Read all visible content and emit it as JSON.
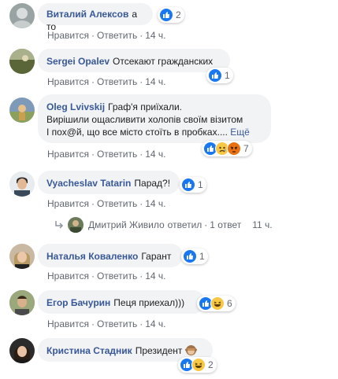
{
  "colors": {
    "link": "#385898",
    "bubble": "#f2f3f5",
    "meta": "#606770",
    "like": "#1877f2"
  },
  "actions": {
    "like": "Нравится",
    "reply": "Ответить"
  },
  "comments": [
    {
      "author": "Виталий Алексов",
      "text": "а то",
      "reactions": [
        "like"
      ],
      "count": "2",
      "time": "14 ч."
    },
    {
      "author": "Sergei Opalev",
      "text": "Отсекают гражданских",
      "reactions": [
        "like"
      ],
      "count": "1",
      "time": "14 ч."
    },
    {
      "author": "Oleg Lvivskij",
      "line1": "Граф'я приїхали.",
      "line2": "Вирішили ощасливити холопів своїм візитом",
      "line3": "І пох@й, що все місто стоїть в пробках....",
      "more": "Ещё",
      "reactions": [
        "like",
        "sad",
        "angry"
      ],
      "count": "7",
      "time": "14 ч."
    },
    {
      "author": "Vyacheslav Tatarin",
      "text": "Парад?!",
      "reactions": [
        "like"
      ],
      "count": "1",
      "time": "14 ч."
    },
    {
      "author": "Наталья Коваленко",
      "text": "Гарант",
      "reactions": [
        "like"
      ],
      "count": "1",
      "time": "14 ч."
    },
    {
      "author": "Егор Бачурин",
      "text": "Пеця приехал)))",
      "reactions": [
        "like",
        "haha"
      ],
      "count": "6",
      "time": "14 ч."
    },
    {
      "author": "Кристина Стадник",
      "text": "Президент",
      "text_emoji": "see-no-evil-monkey",
      "reactions": [
        "like",
        "haha"
      ],
      "count": "2",
      "time": "14 ч."
    }
  ],
  "reply_thread": {
    "name": "Дмитрий Живило",
    "verb": "ответил",
    "count": "1 ответ",
    "time": "11 ч."
  }
}
